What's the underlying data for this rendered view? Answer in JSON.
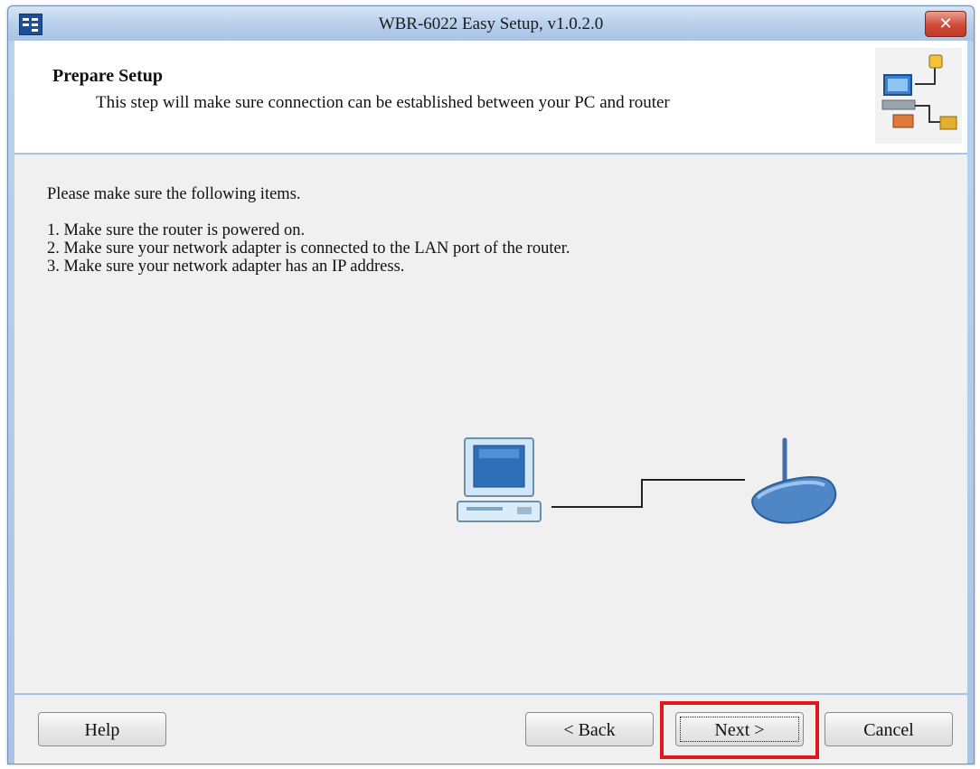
{
  "window": {
    "title": "WBR-6022 Easy Setup, v1.0.2.0",
    "close_glyph": "✕",
    "app_icon": "router-app-icon"
  },
  "header": {
    "title": "Prepare Setup",
    "subtitle": "This step will make sure connection can be established between your PC and router",
    "icon": "network-connection-icon"
  },
  "content": {
    "intro": "Please make sure the following items.",
    "items": [
      "1. Make sure the router is powered on.",
      "2. Make sure your network adapter is connected to the LAN port of the router.",
      "3. Make sure your network adapter has an IP address."
    ],
    "illustration": {
      "left_icon": "computer-icon",
      "right_icon": "wireless-router-icon"
    }
  },
  "buttons": {
    "help": "Help",
    "back": "< Back",
    "next": "Next >",
    "cancel": "Cancel"
  },
  "colors": {
    "highlight": "#e0181e",
    "titlebar": "#b9d0ec",
    "close": "#c0392b"
  }
}
